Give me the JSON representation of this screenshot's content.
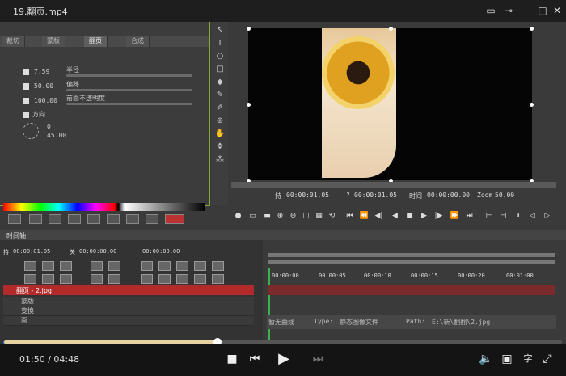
{
  "window": {
    "title": "19.翻页.mp4"
  },
  "left_panel": {
    "tabs": [
      "裁切",
      "蒙版",
      "翻页",
      "合成"
    ],
    "active_tab": "翻页",
    "params": [
      {
        "value": "7.59",
        "label": "半径"
      },
      {
        "value": "50.00",
        "label": "偏移"
      },
      {
        "value": "100.00",
        "label": "前面不透明度"
      }
    ],
    "direction_label": "方向",
    "direction_values": [
      "0",
      "45.00"
    ]
  },
  "preview_info": {
    "in_label": "持",
    "in_time": "00:00:01.05",
    "q_label": "?",
    "q_time": "00:00:01.05",
    "time_label": "时间",
    "time_value": "00:00:00.00",
    "zoom_label": "Zoom",
    "zoom_value": "50.00"
  },
  "timeline": {
    "tab_label": "时间轴",
    "dur_label": "持",
    "dur_time": "00:00:01.05",
    "off_label": "关",
    "off_time": "00:00:00.00",
    "end_time": "00:00:00.00",
    "ruler": [
      "00:00:00",
      "00:00:05",
      "00:00:10",
      "00:00:15",
      "00:00:20",
      "00:01:00"
    ],
    "track_title": "翻页 - 2.jpg",
    "tracks": [
      "蒙版",
      "变换",
      "面"
    ],
    "curve_label": "暂无曲线",
    "type_label": "Type:",
    "type_value": "静态图像文件",
    "path_label": "Path:",
    "path_value": "E:\\新\\翻翻\\2.jpg"
  },
  "player": {
    "current": "01:50",
    "total": "04:48",
    "progress_fraction": 0.382,
    "subtitle_label": "字"
  }
}
